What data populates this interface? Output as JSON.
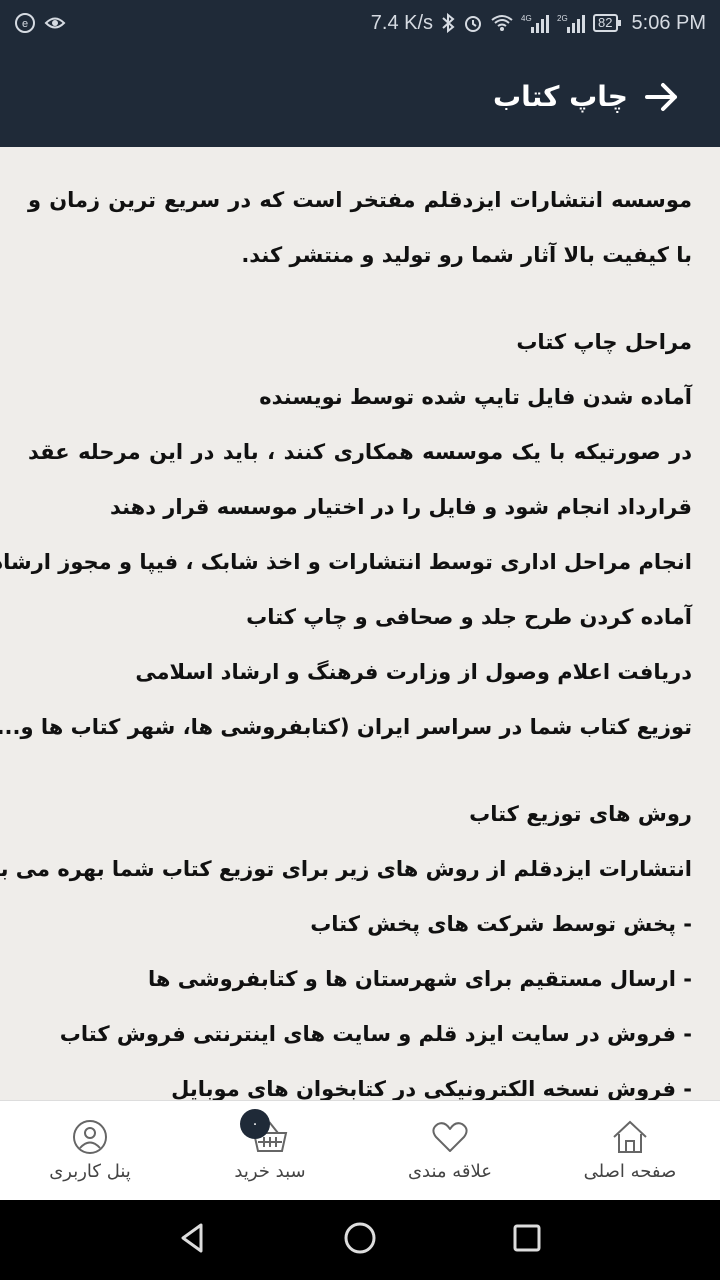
{
  "status_bar": {
    "speed": "7.4 K/s",
    "network1": "4G",
    "network2": "2G",
    "battery": "82",
    "time": "5:06 PM"
  },
  "app_bar": {
    "title": "چاپ کتاب",
    "back_icon": "arrow-right-icon"
  },
  "content": {
    "intro": "موسسه انتشارات ایزدقلم مفتخر است که در سریع ترین زمان و با کیفیت بالا آثار شما رو تولید و منتشر کند.",
    "steps_heading": "مراحل چاپ کتاب",
    "steps": [
      "آماده شدن فایل تایپ شده توسط نویسنده",
      "در صورتیکه با یک موسسه همکاری کنند ، باید در این مرحله عقد",
      "قرارداد انجام شود و فایل را در اختیار موسسه قرار دهند",
      "انجام مراحل اداری توسط انتشارات و اخذ شابک ، فیپا و مجوز ارشاد",
      "آماده کردن طرح جلد و صحافی و چاپ کتاب",
      "دریافت اعلام وصول از وزارت فرهنگ و ارشاد اسلامی",
      "توزیع کتاب شما در سراسر ایران (کتابفروشی ها، شهر کتاب ها و...)"
    ],
    "distribution_heading": "روش های توزیع کتاب",
    "distribution_intro": "انتشارات ایزدقلم از روش های زیر برای توزیع کتاب شما بهره می برد:",
    "distribution_items": [
      "- پخش توسط شرکت های پخش کتاب",
      "- ارسال مستقیم برای شهرستان ها و کتابفروشی ها",
      "- فروش در سایت ایزد قلم و سایت های اینترنتی فروش کتاب",
      "- فروش نسخه الکترونیکی در کتابخوان های موبایل"
    ]
  },
  "bottom_nav": {
    "profile": "پنل کاربری",
    "cart": "سبد خرید",
    "cart_count": "۰",
    "favorites": "علاقه مندی",
    "home": "صفحه اصلی"
  }
}
